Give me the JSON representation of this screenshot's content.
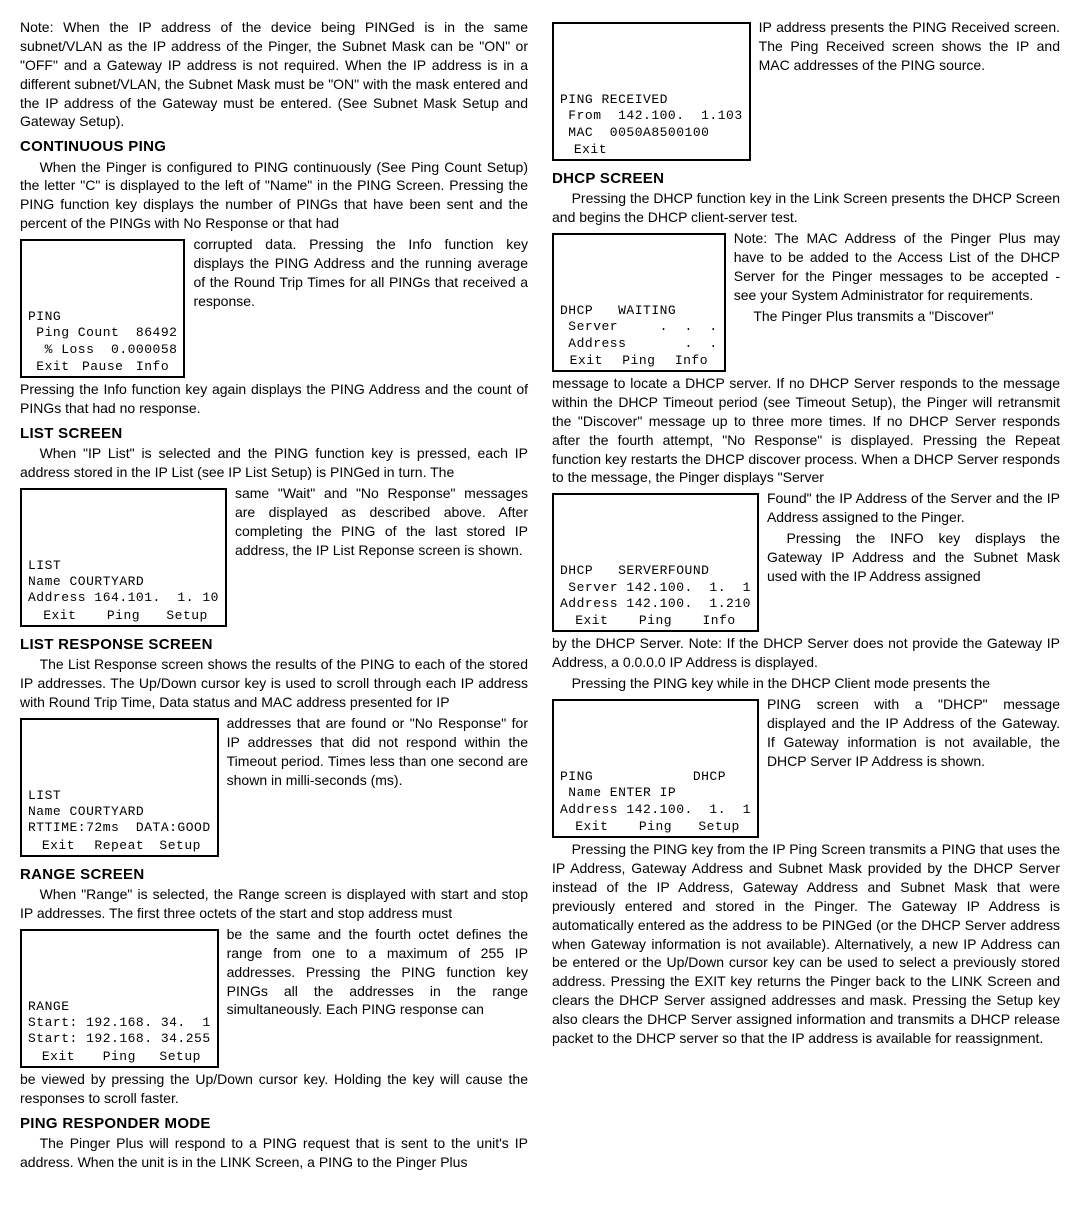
{
  "intro": "Note: When the IP address of the device being PINGed is in the same subnet/VLAN as the IP address of the Pinger, the Subnet Mask can be \"ON\" or \"OFF\" and a Gateway IP address is not required. When the IP address is in a different subnet/VLAN, the Subnet Mask must be \"ON\" with the mask entered and the IP address of the Gateway must be entered. (See Subnet Mask Setup and Gateway Setup).",
  "cont_ping_h": "CONTINUOUS PING",
  "cont_ping_p1": "When the Pinger is configured to PING continuously (See Ping Count Setup) the letter \"C\" is displayed to the left of \"Name\" in the PING Screen. Pressing the PING function key displays the number of PINGs that have been sent and the percent of the PINGs with No Response or that had",
  "cont_ping_side": "corrupted data. Pressing the Info function key displays the PING Address and the running average of the Round Trip Times for all PINGs that received a response.",
  "cont_ping_p2": "Pressing the Info function key again displays the PING Address and the count of PINGs that had no response.",
  "lcd_ping": {
    "l1": "PING",
    "l2": " Ping Count  86492",
    "l3": "  % Loss  0.000058",
    "f1": "Exit",
    "f2": "Pause",
    "f3": "Info"
  },
  "list_h": "LIST SCREEN",
  "list_p1": "When \"IP List\" is selected and the PING function key is pressed, each IP address stored in the IP List (see IP List Setup) is PINGed in turn. The",
  "list_side": "same \"Wait\" and \"No Response\" messages are displayed as described above. After completing the PING of the last stored IP address, the IP List Reponse screen is shown.",
  "lcd_list": {
    "l1": "LIST",
    "l2": "Name COURTYARD",
    "l3": "Address 164.101.  1. 10",
    "f1": "Exit",
    "f2": "Ping",
    "f3": "Setup"
  },
  "listresp_h": "LIST RESPONSE SCREEN",
  "listresp_p1": "The List Response screen shows the results of the PING to each of the stored IP addresses. The Up/Down cursor key is used to scroll through each IP address with Round Trip Time, Data status and MAC address presented for IP",
  "listresp_side": "addresses that are found or \"No Response\" for IP addresses that did not respond within the Timeout period. Times less than one second are shown in milli-seconds (ms).",
  "lcd_listresp": {
    "l1": "LIST",
    "l2": "Name COURTYARD",
    "l3": "RTTIME:72ms  DATA:GOOD",
    "f1": "Exit",
    "f2": "Repeat",
    "f3": "Setup"
  },
  "range_h": "RANGE SCREEN",
  "range_p1": "When \"Range\" is selected, the Range screen is displayed with start and stop IP addresses. The first three octets of the start and stop address must",
  "range_side": "be the same and the fourth octet defines the range from one to a maximum of 255 IP addresses. Pressing the PING function key PINGs all the addresses in the range simultaneously. Each PING response can",
  "range_p2": "be viewed by pressing the Up/Down cursor key. Holding the key will cause the responses to scroll faster.",
  "lcd_range": {
    "l1": "RANGE",
    "l2": "Start: 192.168. 34.  1",
    "l3": "Start: 192.168. 34.255",
    "f1": "Exit",
    "f2": "Ping",
    "f3": "Setup"
  },
  "resp_h": "PING RESPONDER MODE",
  "resp_p1": "The Pinger Plus will respond to a PING request that is sent to the unit's IP address. When the unit is in the LINK Screen, a PING to the Pinger Plus",
  "resp_side": "IP address presents the PING Received screen. The Ping Received screen shows the IP and MAC addresses of the PING source.",
  "lcd_resp": {
    "l1": "PING RECEIVED",
    "l2": " From  142.100.  1.103",
    "l3": " MAC  0050A8500100",
    "f1": "Exit"
  },
  "dhcp_h": "DHCP SCREEN",
  "dhcp_p1": "Pressing the DHCP function key in the Link Screen presents the DHCP Screen and begins the DHCP client-server test.",
  "dhcp_side1": "Note: The MAC Address of the Pinger Plus may have to be added to the Access List of the DHCP Server for the Pinger messages to be accepted - see your System Administrator for requirements.",
  "dhcp_p2a": "The Pinger Plus transmits a \"Discover\"",
  "dhcp_p2": "message to locate a DHCP server. If no DHCP Server responds to the message within the DHCP Timeout period (see Timeout Setup), the Pinger will retransmit the \"Discover\" message up to three more times. If no DHCP Server responds after the fourth attempt, \"No Response\" is displayed. Pressing the Repeat function key restarts the DHCP discover process. When a DHCP Server responds to the message, the Pinger displays \"Server",
  "dhcp_side2": "Found\" the IP Address of the Server and the IP Address assigned to the Pinger.",
  "dhcp_p3a": "Pressing the INFO key displays the Gateway IP Address and the Subnet Mask used with the IP Address assigned",
  "dhcp_p3": "by the DHCP Server. Note: If the DHCP Server does not provide the Gateway IP Address, a 0.0.0.0 IP Address is displayed.",
  "dhcp_p4a": "Pressing the PING key while in the DHCP Client mode presents the",
  "dhcp_side3": "PING screen with a \"DHCP\" message displayed and the IP Address of the Gateway. If Gateway information is not available, the DHCP Server IP Address is shown.",
  "dhcp_p5": "Pressing the PING key from the IP Ping Screen transmits a PING that uses the IP Address, Gateway Address and Subnet Mask provided by the DHCP Server instead of the IP Address, Gateway Address and Subnet Mask that were previously entered and stored in the Pinger. The Gateway IP Address is automatically entered as the address to be PINGed (or the DHCP Server address when Gateway information is not available). Alternatively, a new IP Address can be entered or  the Up/Down cursor key can be used to select a previously stored address. Pressing the EXIT key returns the Pinger back to the LINK Screen and clears the DHCP Server assigned addresses and mask. Pressing the Setup key also clears the DHCP Server assigned information and transmits a DHCP release packet to the DHCP server so that the IP address is available for reassignment.",
  "lcd_dhcp1": {
    "l1": "DHCP   WAITING",
    "l2": " Server     .  .  .",
    "l3": " Address       .  .",
    "f1": "Exit",
    "f2": "Ping",
    "f3": "Info"
  },
  "lcd_dhcp2": {
    "l1": "DHCP   SERVERFOUND",
    "l2": " Server 142.100.  1.  1",
    "l3": "Address 142.100.  1.210",
    "f1": "Exit",
    "f2": "Ping",
    "f3": "Info"
  },
  "lcd_dhcp3": {
    "l1": "PING            DHCP",
    "l2": " Name ENTER IP",
    "l3": "Address 142.100.  1.  1",
    "f1": "Exit",
    "f2": "Ping",
    "f3": "Setup"
  }
}
